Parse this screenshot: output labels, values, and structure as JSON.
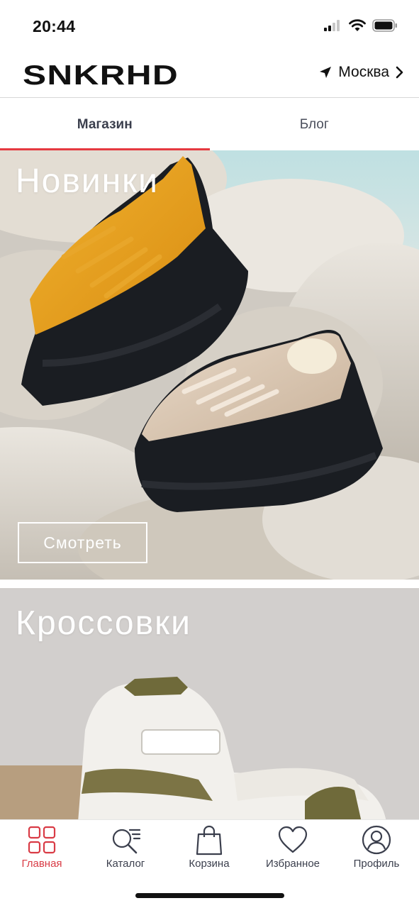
{
  "status_bar": {
    "time": "20:44"
  },
  "header": {
    "logo_text": "SNKRHD",
    "city": "Москва"
  },
  "tabs": [
    {
      "label": "Магазин",
      "active": true
    },
    {
      "label": "Блог",
      "active": false
    }
  ],
  "banners": [
    {
      "title": "Новинки",
      "button_label": "Смотреть"
    },
    {
      "title": "Кроссовки"
    }
  ],
  "bottom_nav": [
    {
      "label": "Главная",
      "icon": "grid-icon",
      "active": true
    },
    {
      "label": "Каталог",
      "icon": "catalog-search-icon",
      "active": false
    },
    {
      "label": "Корзина",
      "icon": "shopping-bag-icon",
      "active": false
    },
    {
      "label": "Избранное",
      "icon": "heart-icon",
      "active": false
    },
    {
      "label": "Профиль",
      "icon": "profile-icon",
      "active": false
    }
  ],
  "colors": {
    "accent": "#e53940",
    "active_nav": "#d93b45",
    "text": "#111111"
  }
}
